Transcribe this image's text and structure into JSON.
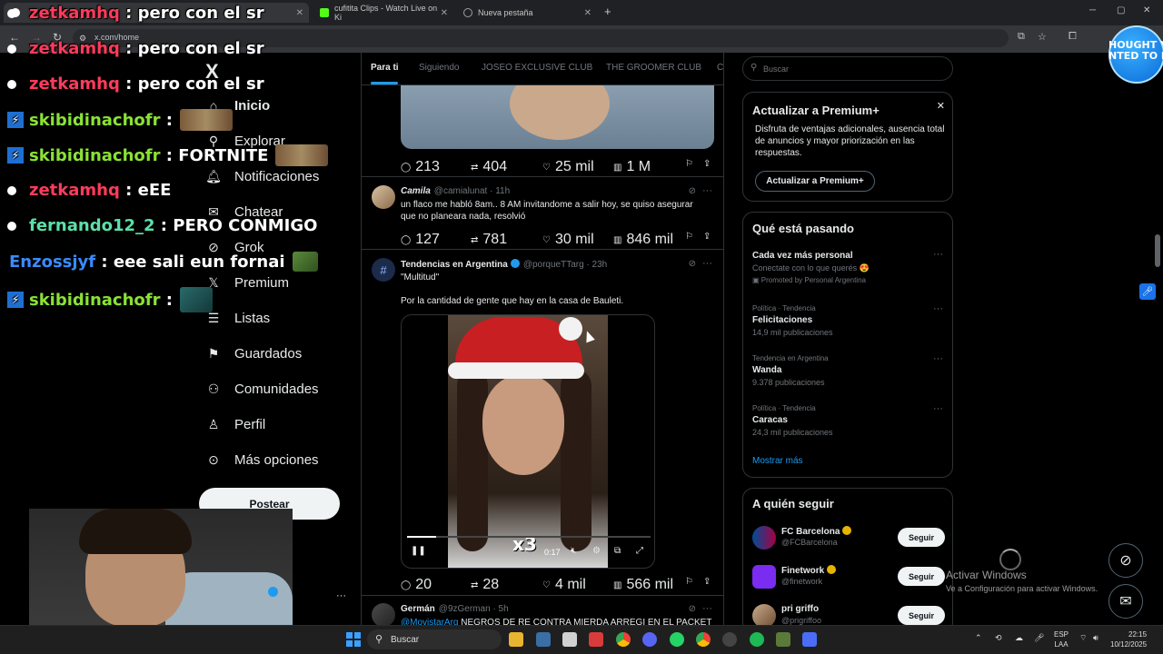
{
  "browser": {
    "tabs": [
      {
        "title": "",
        "active": true
      },
      {
        "title": "cufitita Clips - Watch Live on Ki",
        "active": false
      },
      {
        "title": "Nueva pestaña",
        "active": false
      }
    ],
    "url": "x.com/home"
  },
  "chat": [
    {
      "user": "zetkamhq",
      "msg": "pero con el sr",
      "color": "#ff3b5c",
      "badge": "dot"
    },
    {
      "user": "zetkamhq",
      "msg": "pero con el sr",
      "color": "#ff3b5c",
      "badge": "dot"
    },
    {
      "user": "zetkamhq",
      "msg": "pero con el sr",
      "color": "#ff3b5c",
      "badge": "dot"
    },
    {
      "user": "skibidinachofr",
      "msg": "",
      "color": "#8ae234",
      "badge": "bolt"
    },
    {
      "user": "skibidinachofr",
      "msg": "FORTNITE",
      "color": "#8ae234",
      "badge": "bolt"
    },
    {
      "user": "zetkamhq",
      "msg": "eEE",
      "color": "#ff3b5c",
      "badge": "dot"
    },
    {
      "user": "fernando12_2",
      "msg": "PERO CONMIGO",
      "color": "#5ce0a8",
      "badge": "dot"
    },
    {
      "user": "Enzossjyf",
      "msg": "eee sali eun fornai",
      "color": "#3a8bff",
      "badge": "none"
    },
    {
      "user": "skibidinachofr",
      "msg": "",
      "color": "#8ae234",
      "badge": "bolt"
    }
  ],
  "sidebar": {
    "logo": "X",
    "items": [
      {
        "label": "Inicio",
        "icon": "home-icon"
      },
      {
        "label": "Explorar",
        "icon": "search-icon"
      },
      {
        "label": "Notificaciones",
        "icon": "bell-icon"
      },
      {
        "label": "Chatear",
        "icon": "mail-icon"
      },
      {
        "label": "Grok",
        "icon": "grok-icon"
      },
      {
        "label": "Premium",
        "icon": "x-icon"
      },
      {
        "label": "Listas",
        "icon": "list-icon"
      },
      {
        "label": "Guardados",
        "icon": "bookmark-icon"
      },
      {
        "label": "Comunidades",
        "icon": "people-icon"
      },
      {
        "label": "Perfil",
        "icon": "user-icon"
      },
      {
        "label": "Más opciones",
        "icon": "more-circle-icon"
      }
    ],
    "post_button": "Postear"
  },
  "feed": {
    "tabs": [
      "Para ti",
      "Siguiendo",
      "JOSEO EXCLUSIVE CLUB",
      "THE GROOMER CLUB",
      "C"
    ],
    "first_actions": {
      "replies": "213",
      "reposts": "404",
      "likes": "25 mil",
      "views": "1 M"
    },
    "posts": [
      {
        "name": "Camila",
        "handle": "@camialunat · 11h",
        "text": "un flaco me habló 8am.. 8 AM invitandome a salir hoy, se quiso asegurar que no planeara nada, resolvió",
        "replies": "127",
        "reposts": "781",
        "likes": "30 mil",
        "views": "846 mil"
      },
      {
        "name": "Tendencias en Argentina",
        "handle": "@porqueTTarg · 23h",
        "quote": "\"Multitud\"",
        "text": "Por la cantidad de gente que hay en la casa de Bauleti.",
        "video_time": "0:17",
        "video_progress": 0.12,
        "overlay": "x3",
        "replies": "20",
        "reposts": "28",
        "likes": "4 mil",
        "views": "566 mil"
      },
      {
        "name": "Germán",
        "handle": "@9zGerman · 5h",
        "text_mention": "@MovistarArg",
        "text": " NEGROS DE RE CONTRA MIERDA ARREGI EN EL PACKET"
      }
    ]
  },
  "right": {
    "search_placeholder": "Buscar",
    "premium": {
      "title": "Actualizar a Premium+",
      "desc": "Disfruta de ventajas adicionales, ausencia total de anuncios y mayor priorización en las respuestas.",
      "button": "Actualizar a Premium+"
    },
    "trends_title": "Qué está pasando",
    "trends": [
      {
        "meta": "",
        "name": "Cada vez más personal",
        "sub": "Conectate con lo que querés 😍",
        "extra": "Promoted by Personal Argentina"
      },
      {
        "meta": "Política · Tendencia",
        "name": "Felicitaciones",
        "sub": "14,9 mil publicaciones",
        "extra": ""
      },
      {
        "meta": "Tendencia en Argentina",
        "name": "Wanda",
        "sub": "9.378 publicaciones",
        "extra": ""
      },
      {
        "meta": "Política · Tendencia",
        "name": "Caracas",
        "sub": "24,3 mil publicaciones",
        "extra": ""
      }
    ],
    "show_more": "Mostrar más",
    "follow_title": "A quién seguir",
    "follow": [
      {
        "name": "FC Barcelona",
        "handle": "@FCBarcelona",
        "button": "Seguir",
        "color": "#a50044"
      },
      {
        "name": "Finetwork",
        "handle": "@finetwork",
        "button": "Seguir",
        "color": "#7a2cf0"
      },
      {
        "name": "pri griffo",
        "handle": "@prigriffoo",
        "button": "Seguir",
        "color": "#8a6a4a"
      }
    ]
  },
  "overlay_badge": "HOUGHT Y\nNTED TO D",
  "windows": {
    "activate": "Activar Windows",
    "activate_sub": "Ve a Configuración para activar Windows.",
    "taskbar_search": "Buscar",
    "lang_top": "ESP",
    "lang_bottom": "LAA",
    "time": "22:15",
    "date": "10/12/2025"
  }
}
